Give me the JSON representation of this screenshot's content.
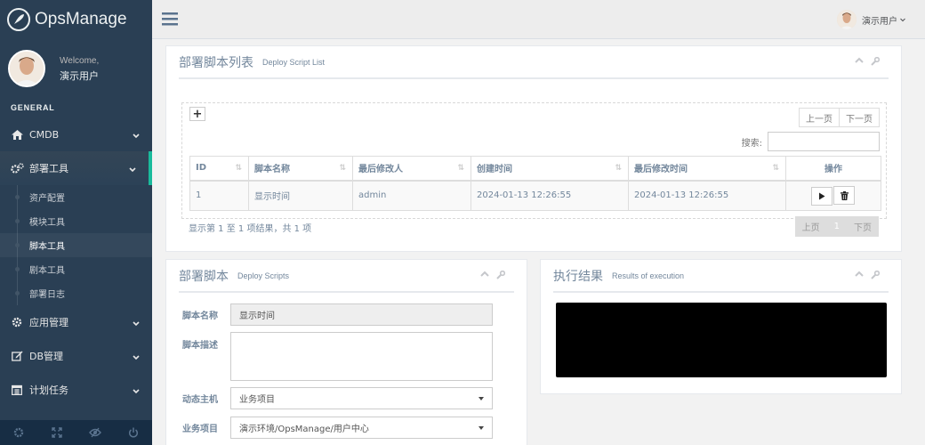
{
  "brand": {
    "name": "OpsManage"
  },
  "profile": {
    "welcome": "Welcome,",
    "name": "演示用户"
  },
  "sidebar": {
    "section": "GENERAL",
    "items": [
      {
        "label": "CMDB",
        "icon": "home-icon"
      },
      {
        "label": "部署工具",
        "icon": "gears-icon",
        "active": true,
        "children": [
          "资产配置",
          "模块工具",
          "脚本工具",
          "剧本工具",
          "部署日志"
        ],
        "current_child": "脚本工具"
      },
      {
        "label": "应用管理",
        "icon": "cog-icon"
      },
      {
        "label": "DB管理",
        "icon": "edit-icon"
      },
      {
        "label": "计划任务",
        "icon": "calendar-icon"
      }
    ]
  },
  "topnav": {
    "user": "演示用户"
  },
  "script_list": {
    "title": "部署脚本列表",
    "subtitle": "Deploy Script List",
    "pager_top": {
      "prev": "上一页",
      "next": "下一页"
    },
    "search_label": "搜索:",
    "columns": [
      "ID",
      "脚本名称",
      "最后修改人",
      "创建时间",
      "最后修改时间",
      "操作"
    ],
    "rows": [
      {
        "id": "1",
        "name": "显示时间",
        "modifier": "admin",
        "created": "2024-01-13 12:26:55",
        "modified": "2024-01-13 12:26:55"
      }
    ],
    "info": "显示第 1 至 1 项结果，共 1 项",
    "pager_bottom": {
      "prev": "上页",
      "page": "1",
      "next": "下页"
    }
  },
  "deploy_form": {
    "title": "部署脚本",
    "subtitle": "Deploy Scripts",
    "fields": {
      "name_label": "脚本名称",
      "name_value": "显示时间",
      "desc_label": "脚本描述",
      "desc_value": "",
      "host_label": "动态主机",
      "host_value": "业务项目",
      "project_label": "业务项目",
      "project_value": "演示环境/OpsManage/用户中心"
    }
  },
  "results": {
    "title": "执行结果",
    "subtitle": "Results of execution"
  }
}
